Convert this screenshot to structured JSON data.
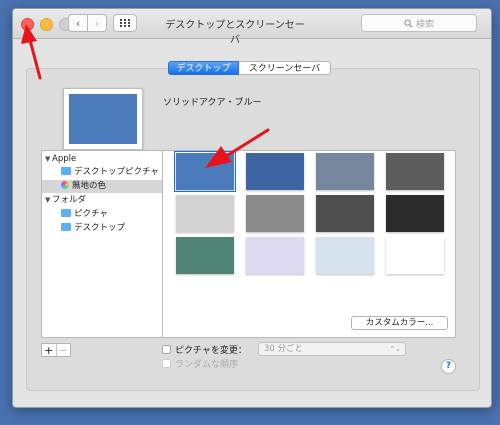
{
  "window": {
    "title": "デスクトップとスクリーンセーバ",
    "search_placeholder": "検索",
    "nav_back_icon": "chevron-left-icon",
    "nav_forward_icon": "chevron-right-icon",
    "grid_icon": "app-grid-icon"
  },
  "tabs": [
    {
      "label": "デスクトップ",
      "active": true
    },
    {
      "label": "スクリーンセーバ",
      "active": false
    }
  ],
  "preview": {
    "label": "ソリッドアクア・ブルー",
    "color": "#4c7bbc"
  },
  "sidebar": {
    "groups": [
      {
        "label": "Apple",
        "items": [
          {
            "label": "デスクトップピクチャ",
            "icon": "folder-icon",
            "selected": false
          },
          {
            "label": "無地の色",
            "icon": "color-wheel-icon",
            "selected": true
          }
        ]
      },
      {
        "label": "フォルダ",
        "items": [
          {
            "label": "ピクチャ",
            "icon": "pictures-folder-icon",
            "selected": false
          },
          {
            "label": "デスクトップ",
            "icon": "folder-icon",
            "selected": false
          }
        ]
      }
    ]
  },
  "swatches": [
    {
      "name": "solid-aqua-blue",
      "color": "#4c7bbc",
      "selected": true
    },
    {
      "name": "solid-aqua-dark-blue",
      "color": "#3e65a2",
      "selected": false
    },
    {
      "name": "solid-slate",
      "color": "#76869d",
      "selected": false
    },
    {
      "name": "solid-dark-gray",
      "color": "#5d5d5d",
      "selected": false
    },
    {
      "name": "solid-light-gray",
      "color": "#d2d2d2",
      "selected": false
    },
    {
      "name": "solid-medium-gray",
      "color": "#8b8b8b",
      "selected": false
    },
    {
      "name": "solid-charcoal",
      "color": "#4e4e4e",
      "selected": false
    },
    {
      "name": "solid-black",
      "color": "#2c2c2c",
      "selected": false
    },
    {
      "name": "solid-teal",
      "color": "#508475",
      "selected": false
    },
    {
      "name": "solid-lavender",
      "color": "#dcd9f0",
      "selected": false
    },
    {
      "name": "solid-pale-blue",
      "color": "#d3e2ed",
      "selected": false
    },
    {
      "name": "solid-white",
      "color": "#ffffff",
      "selected": false
    }
  ],
  "custom_color_button": "カスタムカラー...",
  "add_button": "+",
  "remove_button": "−",
  "change_picture": {
    "label": "ピクチャを変更：",
    "checked": false,
    "interval": "30 分ごと"
  },
  "random_order": {
    "label": "ランダムな順序",
    "checked": false,
    "enabled": false
  },
  "help_label": "?",
  "colors": {
    "accent": "#1b6fe0",
    "annotation_arrow": "#e8141c"
  }
}
